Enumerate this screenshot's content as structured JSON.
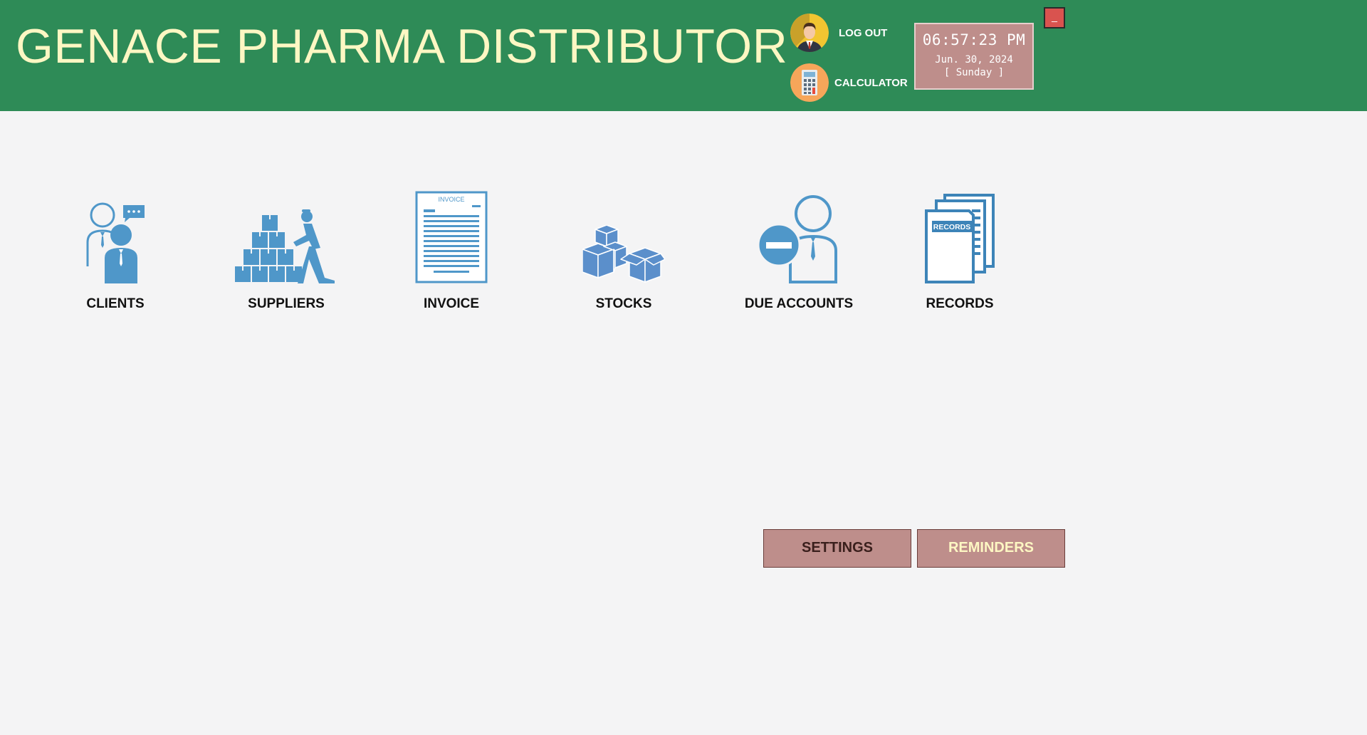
{
  "app": {
    "title": "GENACE PHARMA DISTRIBUTOR"
  },
  "header": {
    "logout_label": "LOG OUT",
    "calculator_label": "CALCULATOR",
    "minimize_label": "_"
  },
  "clock": {
    "time": "06:57:23 PM",
    "date": "Jun. 30, 2024",
    "day": "[ Sunday ]"
  },
  "modules": {
    "clients": {
      "label": "CLIENTS",
      "icon": "clients-icon"
    },
    "suppliers": {
      "label": "SUPPLIERS",
      "icon": "suppliers-icon"
    },
    "invoice": {
      "label": "INVOICE",
      "icon": "invoice-icon",
      "icon_text": "INVOICE"
    },
    "stocks": {
      "label": "STOCKS",
      "icon": "stocks-icon"
    },
    "due_accounts": {
      "label": "DUE ACCOUNTS",
      "icon": "due-accounts-icon"
    },
    "records": {
      "label": "RECORDS",
      "icon": "records-icon",
      "icon_text": "RECORDS"
    }
  },
  "actions": {
    "settings_label": "SETTINGS",
    "reminders_label": "REMINDERS"
  },
  "colors": {
    "header_bg": "#2e8b57",
    "title_text": "#fdf7c3",
    "button_bg": "#be8e8b",
    "icon_blue": "#4f97c9",
    "minimize_bg": "#d9534f",
    "settings_text": "#3a1f1c",
    "reminders_text": "#fdf7c3"
  }
}
